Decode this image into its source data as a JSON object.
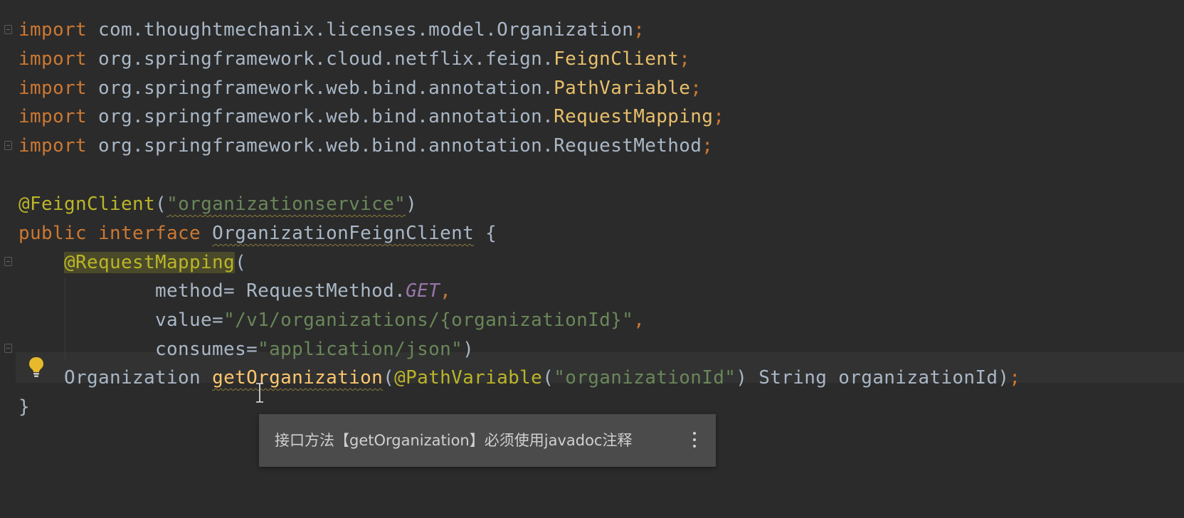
{
  "editor": {
    "lines": [
      {
        "parts": [
          [
            "kw",
            "import"
          ],
          [
            "pl",
            " com.thoughtmechanix.licenses.model."
          ],
          [
            "ty",
            "Organization"
          ],
          [
            "sep",
            ";"
          ]
        ]
      },
      {
        "parts": [
          [
            "kw",
            "import"
          ],
          [
            "pl",
            " org.springframework.cloud.netflix.feign."
          ],
          [
            "cls-y",
            "FeignClient"
          ],
          [
            "sep",
            ";"
          ]
        ]
      },
      {
        "parts": [
          [
            "kw",
            "import"
          ],
          [
            "pl",
            " org.springframework.web.bind.annotation."
          ],
          [
            "cls-y",
            "PathVariable"
          ],
          [
            "sep",
            ";"
          ]
        ]
      },
      {
        "parts": [
          [
            "kw",
            "import"
          ],
          [
            "pl",
            " org.springframework.web.bind.annotation."
          ],
          [
            "cls-y",
            "RequestMapping"
          ],
          [
            "sep",
            ";"
          ]
        ]
      },
      {
        "parts": [
          [
            "kw",
            "import"
          ],
          [
            "pl",
            " org.springframework.web.bind.annotation."
          ],
          [
            "ty",
            "RequestMethod"
          ],
          [
            "sep",
            ";"
          ]
        ]
      },
      {
        "parts": []
      },
      {
        "parts": [
          [
            "ann",
            "@FeignClient"
          ],
          [
            "pl",
            "("
          ],
          [
            "str-warn",
            "\"organizationservice\""
          ],
          [
            "pl",
            ")"
          ]
        ]
      },
      {
        "parts": [
          [
            "kw",
            "public interface "
          ],
          [
            "ty-warn",
            "OrganizationFeignClient"
          ],
          [
            "pl",
            " {"
          ]
        ]
      },
      {
        "parts": [
          [
            "pl",
            "    "
          ],
          [
            "ann-hl",
            "@RequestMapping"
          ],
          [
            "pl",
            "("
          ]
        ]
      },
      {
        "parts": [
          [
            "pl",
            "            method= RequestMethod."
          ],
          [
            "const",
            "GET"
          ],
          [
            "sep",
            ","
          ]
        ]
      },
      {
        "parts": [
          [
            "pl",
            "            value="
          ],
          [
            "str",
            "\"/v1/organizations/{organizationId}\""
          ],
          [
            "sep",
            ","
          ]
        ]
      },
      {
        "parts": [
          [
            "pl",
            "            consumes="
          ],
          [
            "str",
            "\"application/json\""
          ],
          [
            "pl",
            ")"
          ]
        ]
      },
      {
        "parts": [
          [
            "pl",
            "    Organization "
          ],
          [
            "method-warn",
            "getOrganization"
          ],
          [
            "pl",
            "("
          ],
          [
            "ann",
            "@PathVariable"
          ],
          [
            "pl",
            "("
          ],
          [
            "str",
            "\"organizationId\""
          ],
          [
            "pl",
            ") String organizationId)"
          ],
          [
            "sep",
            ";"
          ]
        ]
      },
      {
        "parts": [
          [
            "pl",
            "}"
          ]
        ]
      }
    ]
  },
  "tooltip": {
    "message": "接口方法【getOrganization】必须使用javadoc注释",
    "more_icon": "more-vertical-icon"
  },
  "gutter": {
    "bulb_icon": "lightbulb-icon"
  },
  "colors": {
    "background": "#2b2b2b",
    "keyword": "#cc7832",
    "annotation": "#bbb529",
    "string": "#6a8759",
    "constant": "#9876aa",
    "text": "#a9b7c6",
    "tooltip_bg": "#4b4b4b"
  }
}
